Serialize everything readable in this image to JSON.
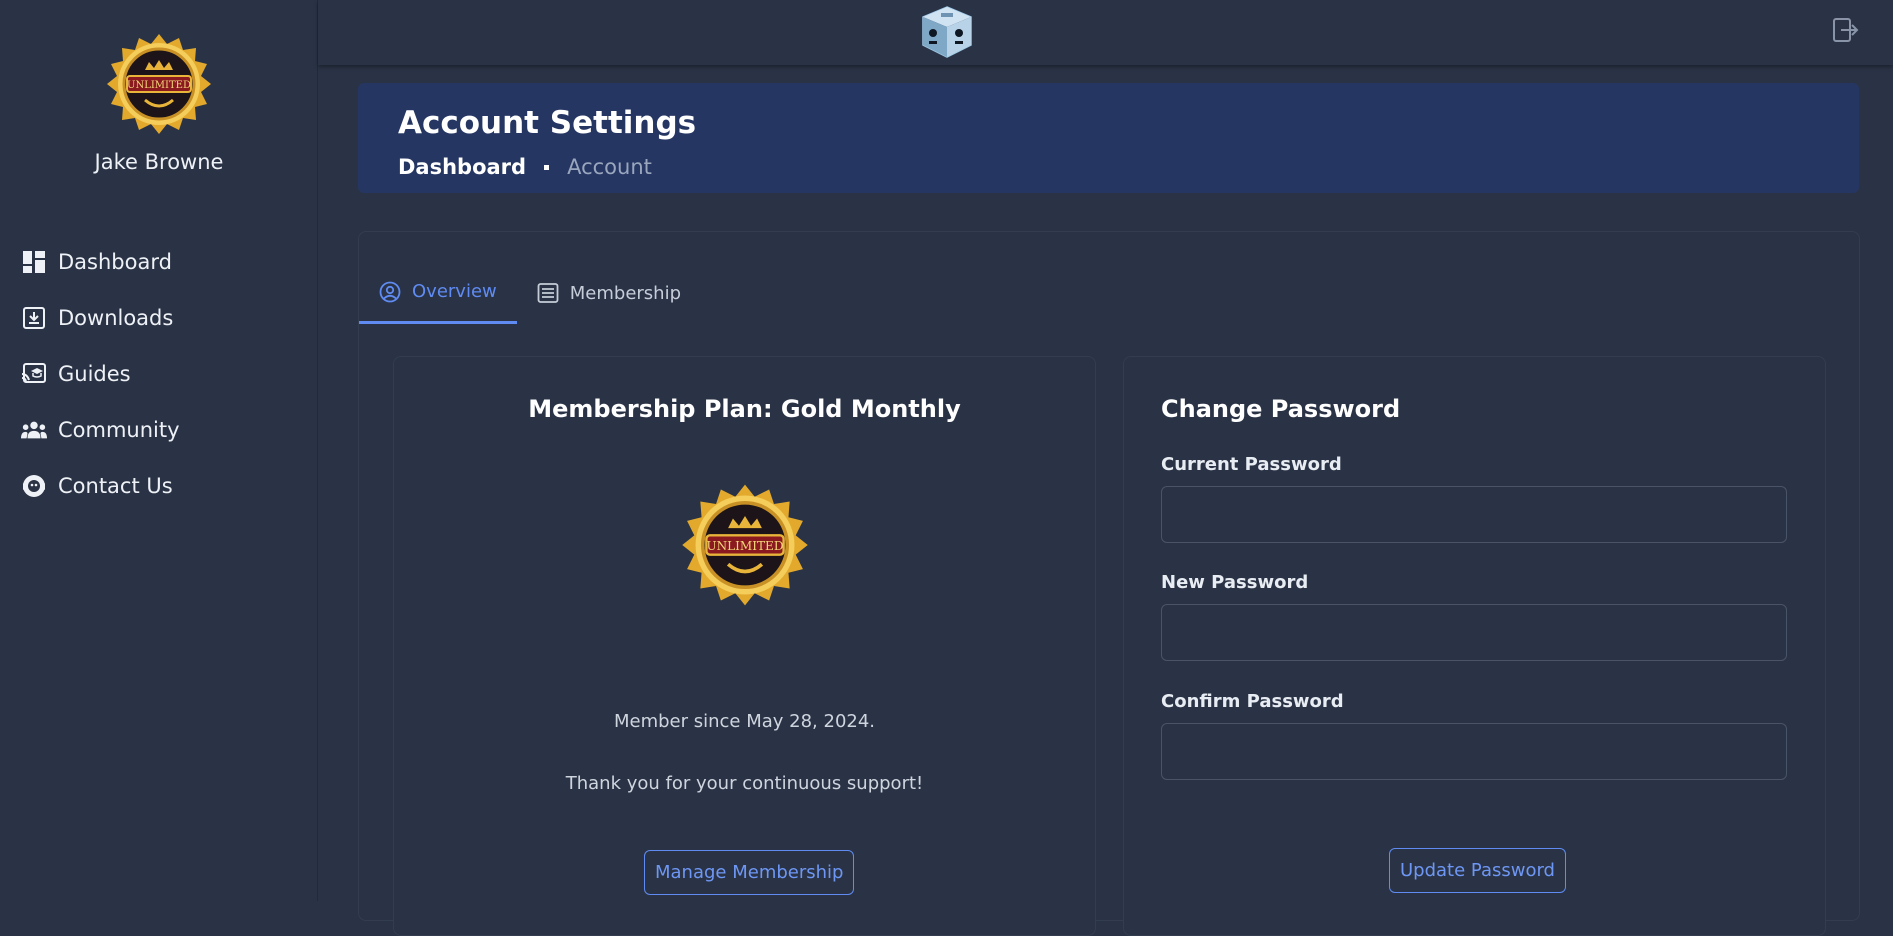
{
  "user": {
    "name": "Jake Browne",
    "badge_text": "UNLIMITED"
  },
  "sidebar": {
    "items": [
      {
        "label": "Dashboard",
        "icon": "dashboard-icon"
      },
      {
        "label": "Downloads",
        "icon": "download-icon"
      },
      {
        "label": "Guides",
        "icon": "guides-icon"
      },
      {
        "label": "Community",
        "icon": "community-icon"
      },
      {
        "label": "Contact Us",
        "icon": "support-icon"
      }
    ]
  },
  "topbar": {
    "logo_icon": "cube-robot-logo",
    "logout_icon": "logout-icon"
  },
  "header": {
    "title": "Account Settings",
    "breadcrumb": {
      "home": "Dashboard",
      "current": "Account"
    }
  },
  "tabs": [
    {
      "label": "Overview",
      "icon": "user-circle-icon",
      "active": true
    },
    {
      "label": "Membership",
      "icon": "list-icon",
      "active": false
    }
  ],
  "membership": {
    "title": "Membership Plan: Gold Monthly",
    "badge_text": "UNLIMITED",
    "member_since": "Member since May 28, 2024.",
    "thanks": "Thank you for your continuous support!",
    "manage_button": "Manage Membership"
  },
  "password": {
    "title": "Change Password",
    "current_label": "Current Password",
    "new_label": "New Password",
    "confirm_label": "Confirm Password",
    "current_value": "",
    "new_value": "",
    "confirm_value": "",
    "update_button": "Update Password"
  },
  "colors": {
    "background": "#2a3345",
    "banner": "#253662",
    "accent": "#5f8bf2",
    "gold": "#e8b43a"
  }
}
